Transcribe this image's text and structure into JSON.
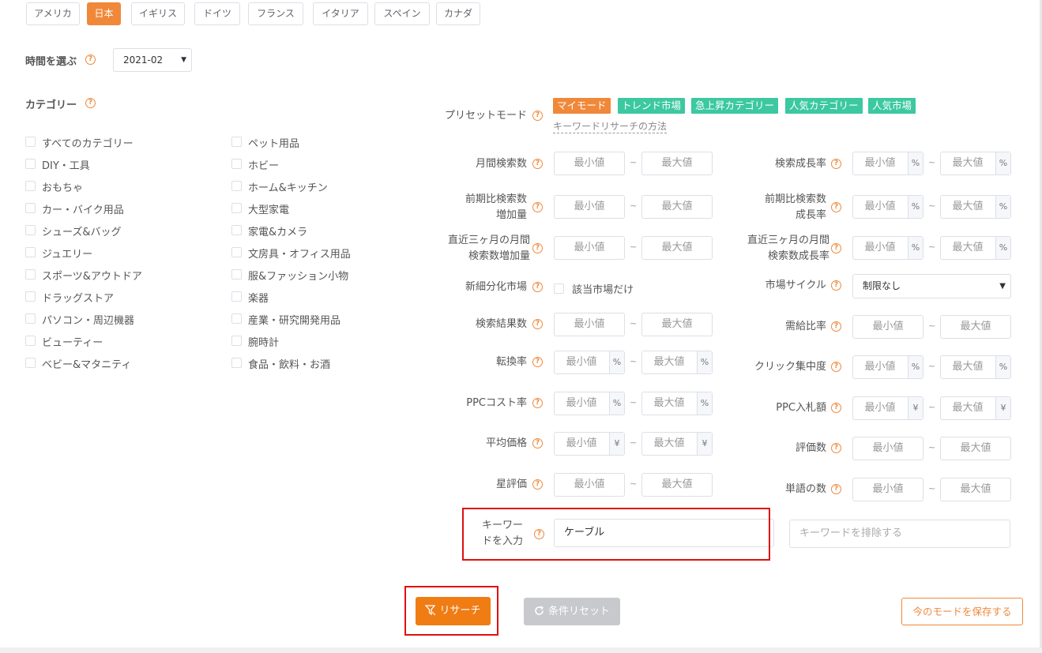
{
  "countries": [
    "アメリカ",
    "日本",
    "イギリス",
    "ドイツ",
    "フランス",
    "イタリア",
    "スペイン",
    "カナダ"
  ],
  "active_country": "日本",
  "time": {
    "label": "時間を選ぶ",
    "value": "2021-02"
  },
  "category": {
    "label": "カテゴリー",
    "left": [
      "すべてのカテゴリー",
      "DIY・工具",
      "おもちゃ",
      "カー・バイク用品",
      "シューズ&バッグ",
      "ジュエリー",
      "スポーツ&アウトドア",
      "ドラッグストア",
      "パソコン・周辺機器",
      "ビューティー",
      "ベビー&マタニティ"
    ],
    "right": [
      "ペット用品",
      "ホビー",
      "ホーム&キッチン",
      "大型家電",
      "家電&カメラ",
      "文房具・オフィス用品",
      "服&ファッション小物",
      "楽器",
      "産業・研究開発用品",
      "腕時計",
      "食品・飲料・お酒"
    ]
  },
  "preset": {
    "label": "プリセットモード",
    "modes": [
      "マイモード",
      "トレンド市場",
      "急上昇カテゴリー",
      "人気カテゴリー",
      "人気市場"
    ],
    "method_link": "キーワードリサーチの方法"
  },
  "filters": {
    "min": "最小値",
    "max": "最大値",
    "tilde": "~",
    "percent": "%",
    "yen": "¥",
    "monthly_search": "月間検索数",
    "search_growth": "検索成長率",
    "prev_search_inc_1": "前期比検索数",
    "prev_search_inc_2": "増加量",
    "prev_search_growth_1": "前期比検索数",
    "prev_search_growth_2": "成長率",
    "recent3_inc_1": "直近三ヶ月の月間",
    "recent3_inc_2": "検索数増加量",
    "recent3_growth_1": "直近三ヶ月の月間",
    "recent3_growth_2": "検索数成長率",
    "new_segment": "新細分化市場",
    "new_segment_check": "該当市場だけ",
    "market_cycle": "市場サイクル",
    "market_cycle_value": "制限なし",
    "search_results": "検索結果数",
    "supply_demand": "需給比率",
    "conversion": "転換率",
    "click_concentration": "クリック集中度",
    "ppc_cost": "PPCコスト率",
    "ppc_bid": "PPC入札額",
    "avg_price": "平均価格",
    "review_count": "評価数",
    "star_rating": "星評価",
    "word_count": "単語の数"
  },
  "keyword": {
    "label_1": "キーワー",
    "label_2": "ドを入力",
    "value": "ケーブル",
    "exclude_placeholder": "キーワードを排除する"
  },
  "buttons": {
    "research": "リサーチ",
    "reset": "条件リセット",
    "save_mode": "今のモードを保存する"
  },
  "colors": {
    "accent": "#f0883a",
    "preset_green": "#3cc8a0",
    "highlight": "#e01010"
  }
}
